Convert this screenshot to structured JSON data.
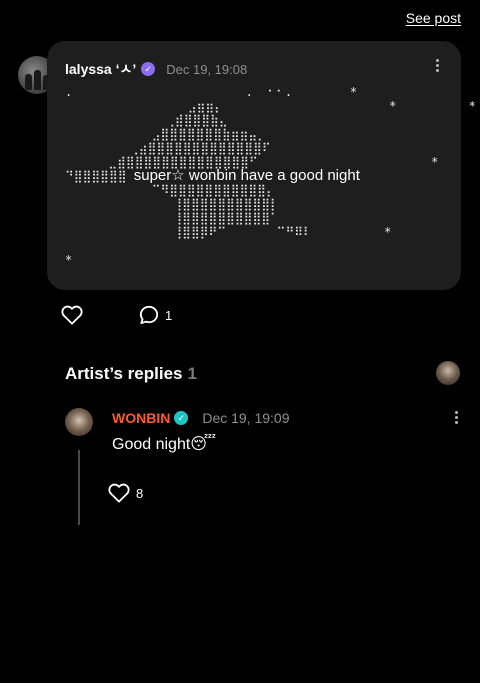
{
  "header": {
    "see_post_label": "See post"
  },
  "post": {
    "username": "lalyssa ‘ㅅ’",
    "verified_icon": "verified-badge-purple",
    "timestamp": "Dec 19, 19:08",
    "art_lines": [
      ".                        .  ⠂⠂.        *",
      "                 ⣠⣶⣶⡄                       *          *",
      "              ⢀⣾⣿⣿⣿⣷⣄",
      "            ⣠⣿⣿⣿⣿⣿⣿⣿⣷⣶⣶⣤⡀",
      "         ⢀⣴⣿⣿⣿⣿⣿⣿⣿⣿⣿⣿⣿⣿⣿⠏",
      "      ⣀⣾⣿⣿⣿⣿⣿⣿⣿⣿⣿⣿⣿⣿⣿⣿⠋                        *"
    ],
    "message_prefix": "⠙⣿⣿⣿⣿⣿⣿ ",
    "message": "super☆ wonbin have a good night",
    "art_lines_after": [
      "            ⠉⠻⣿⣿⣿⣿⣿⣿⣿⣿⣿⣿⣿⡄",
      "               ⢸⣿⣿⣿⣿⣿⣿⣿⣿⣿⣿⡇",
      "               ⢸⣿⣿⣿⣿⣿⣿⣿⣿⣿⣿⠁",
      "               ⢸⣿⣿⡿⠟⠉       ⠉⠛⠿⠇          *",
      "",
      "*"
    ],
    "comment_count": "1"
  },
  "artist_replies": {
    "title": "Artist’s replies",
    "count": "1"
  },
  "reply": {
    "author": "WONBIN",
    "verified_icon": "verified-badge-teal",
    "timestamp": "Dec 19, 19:09",
    "text": "Good night😴",
    "likes": "8"
  },
  "colors": {
    "background": "#000000",
    "bubble": "#1e1e1e",
    "artist_name": "#ff5a2b",
    "post_verified": "#8b6cf0",
    "artist_verified": "#1fc4c4",
    "muted_text": "#8e8e8e"
  }
}
